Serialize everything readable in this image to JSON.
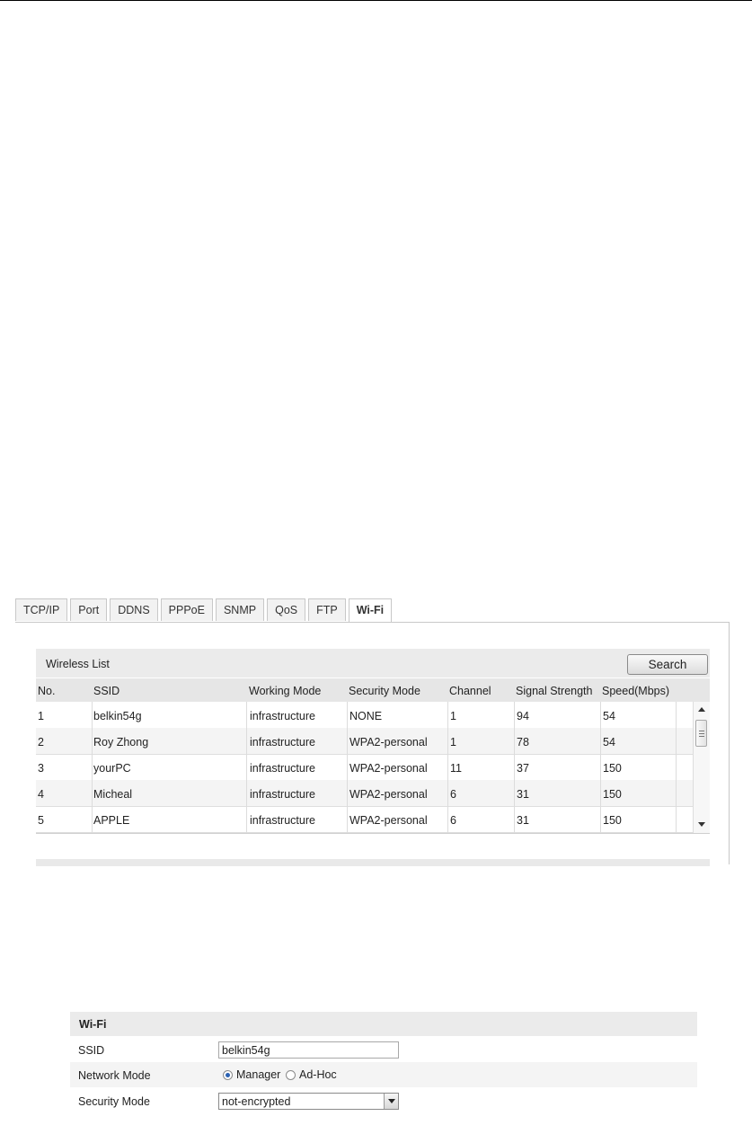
{
  "tabs": [
    "TCP/IP",
    "Port",
    "DDNS",
    "PPPoE",
    "SNMP",
    "QoS",
    "FTP",
    "Wi-Fi"
  ],
  "active_tab": "Wi-Fi",
  "wireless_list": {
    "title": "Wireless List",
    "search_label": "Search",
    "columns": [
      "No.",
      "SSID",
      "Working Mode",
      "Security Mode",
      "Channel",
      "Signal Strength",
      "Speed(Mbps)"
    ],
    "rows": [
      [
        "1",
        "belkin54g",
        "infrastructure",
        "NONE",
        "1",
        "94",
        "54"
      ],
      [
        "2",
        "Roy Zhong",
        "infrastructure",
        "WPA2-personal",
        "1",
        "78",
        "54"
      ],
      [
        "3",
        "yourPC",
        "infrastructure",
        "WPA2-personal",
        "11",
        "37",
        "150"
      ],
      [
        "4",
        "Micheal",
        "infrastructure",
        "WPA2-personal",
        "6",
        "31",
        "150"
      ],
      [
        "5",
        "APPLE",
        "infrastructure",
        "WPA2-personal",
        "6",
        "31",
        "150"
      ]
    ]
  },
  "wifi_form": {
    "header": "Wi-Fi",
    "ssid_label": "SSID",
    "ssid_value": "belkin54g",
    "network_mode_label": "Network Mode",
    "network_mode_options": [
      "Manager",
      "Ad-Hoc"
    ],
    "network_mode_selected": "Manager",
    "security_mode_label": "Security Mode",
    "security_mode_value": "not-encrypted"
  },
  "icons": {
    "scroll_up": "arrow-up-icon",
    "scroll_down": "arrow-down-icon",
    "dropdown": "chevron-down-icon"
  },
  "colors": {
    "header_bg": "#ebebeb",
    "alt_row_bg": "#f4f4f4",
    "radio_selected": "#2b62b3"
  }
}
